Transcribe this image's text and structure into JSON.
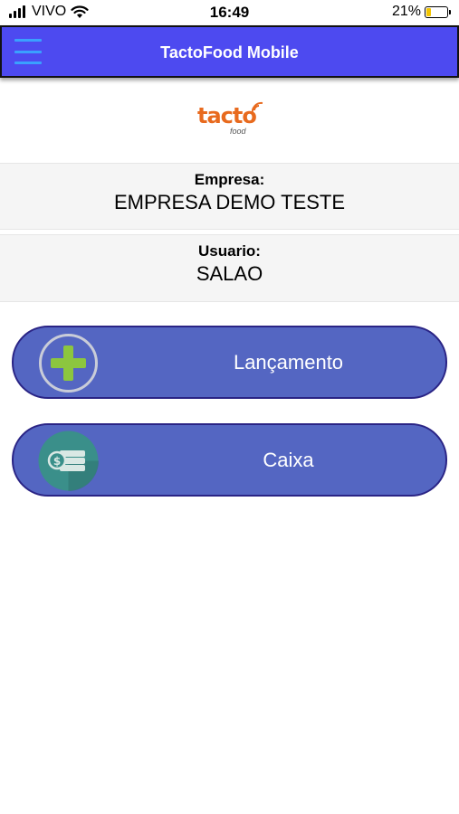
{
  "status_bar": {
    "carrier": "VIVO",
    "time": "16:49",
    "battery_percent": "21%",
    "battery_level": 0.21,
    "battery_color": "#f2c400",
    "signal_icon": "cellular-signal-icon",
    "wifi_icon": "wifi-icon"
  },
  "header": {
    "title": "TactoFood Mobile",
    "background_color": "#4d4af0",
    "menu_icon": "hamburger-menu-icon"
  },
  "logo": {
    "text": "tacto",
    "subtext": "food",
    "color": "#e86a1e"
  },
  "company": {
    "label": "Empresa:",
    "value": "EMPRESA DEMO TESTE"
  },
  "user": {
    "label": "Usuario:",
    "value": "SALAO"
  },
  "actions": {
    "lancamento": {
      "label": "Lançamento",
      "icon": "plus-circle-icon"
    },
    "caixa": {
      "label": "Caixa",
      "icon": "cash-money-icon"
    },
    "button_color": "#5466c2"
  }
}
